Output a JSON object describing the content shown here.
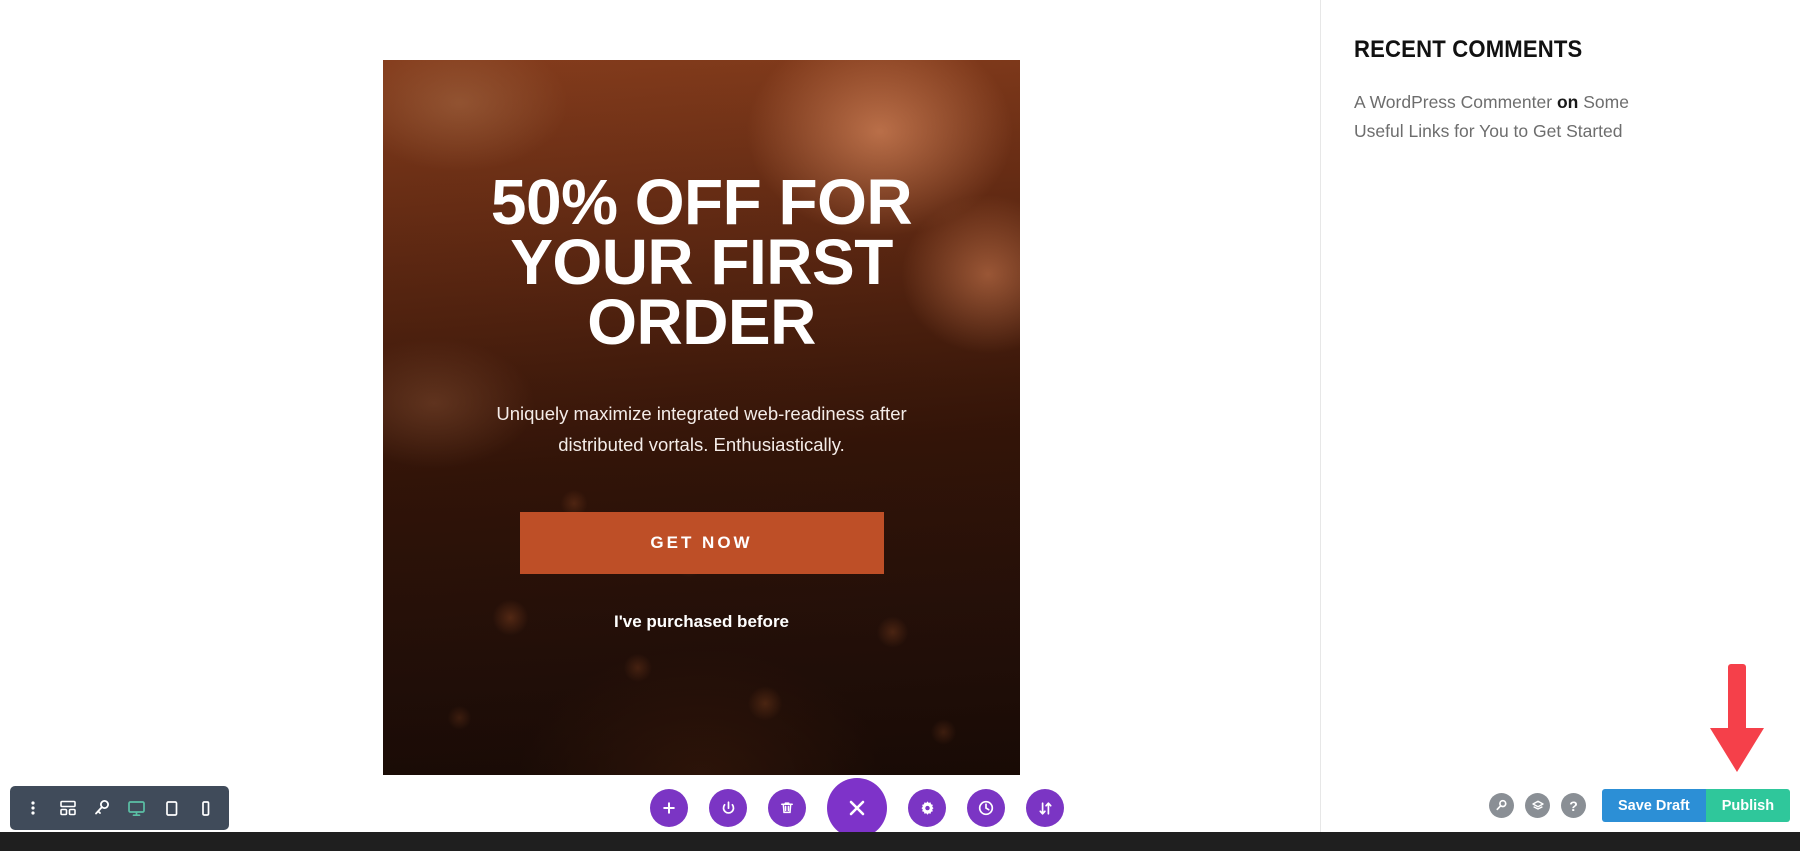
{
  "hero": {
    "title": "50% OFF FOR YOUR FIRST ORDER",
    "subtitle": "Uniquely maximize integrated web-readiness after distributed vortals. Enthusiastically.",
    "cta_label": "GET NOW",
    "secondary_link": "I've purchased before",
    "cta_color": "#BE4F27"
  },
  "sidebar": {
    "heading": "RECENT COMMENTS",
    "comment": {
      "author": "A WordPress Commenter",
      "connector": "on",
      "post_title": "Some Useful Links for You to Get Started"
    }
  },
  "responsive_toolbar": {
    "items": [
      {
        "name": "more-options-icon",
        "label": "More options"
      },
      {
        "name": "layout-grid-icon",
        "label": "Layout"
      },
      {
        "name": "zoom-key-icon",
        "label": "Preview size"
      },
      {
        "name": "desktop-icon",
        "label": "Desktop",
        "active": true
      },
      {
        "name": "tablet-icon",
        "label": "Tablet",
        "active": false
      },
      {
        "name": "mobile-icon",
        "label": "Mobile",
        "active": false
      }
    ],
    "active_color": "#5BC0A5",
    "background": "#404B5A"
  },
  "builder_toolbar": {
    "color": "#7B35C4",
    "items": [
      {
        "name": "add-section-icon",
        "label": "Add New Section"
      },
      {
        "name": "power-toggle-icon",
        "label": "Toggle Builder"
      },
      {
        "name": "trash-icon",
        "label": "Clear Layout"
      },
      {
        "name": "close-icon",
        "label": "Close Builder",
        "main": true
      },
      {
        "name": "settings-gear-icon",
        "label": "Page Settings"
      },
      {
        "name": "history-clock-icon",
        "label": "Editing History"
      },
      {
        "name": "sort-arrows-icon",
        "label": "Responsive / Reorder"
      }
    ]
  },
  "publish_bar": {
    "tools": [
      {
        "name": "search-icon",
        "label": "Search"
      },
      {
        "name": "layers-icon",
        "label": "Layers"
      },
      {
        "name": "help-icon",
        "label": "Help"
      }
    ],
    "save_draft_label": "Save Draft",
    "publish_label": "Publish",
    "save_draft_color": "#2C8FD6",
    "publish_color": "#2FC79B"
  },
  "annotation": {
    "arrow_color": "#F5404A",
    "points_to": "Publish"
  }
}
